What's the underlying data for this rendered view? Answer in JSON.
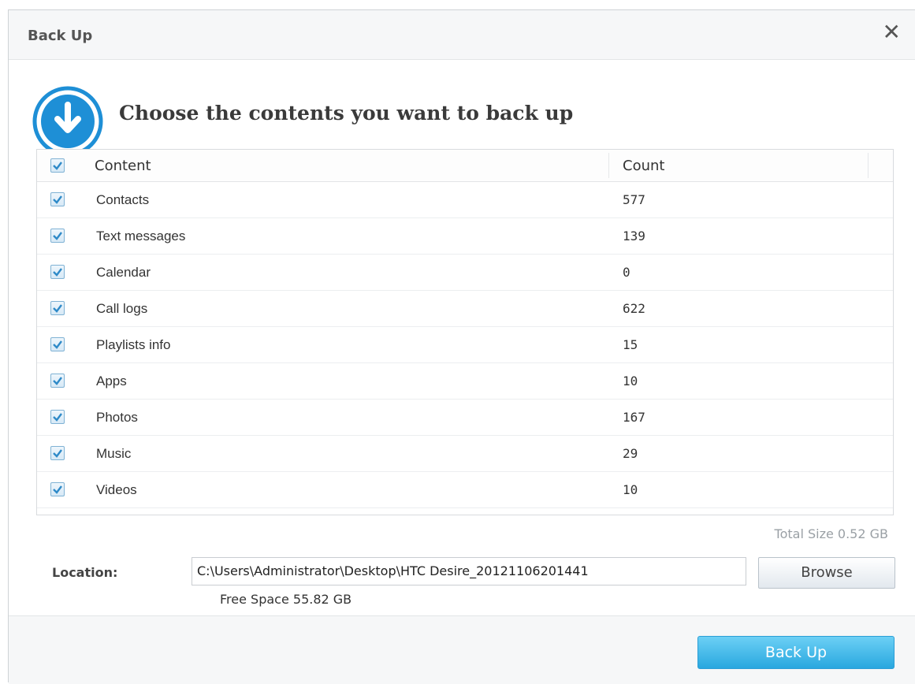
{
  "dialog": {
    "title": "Back Up",
    "close_glyph": "✕",
    "heading": "Choose the contents you want to back up",
    "header_icon": "download-arrow-icon"
  },
  "table": {
    "headers": {
      "content": "Content",
      "count": "Count"
    },
    "select_all_checked": true,
    "rows": [
      {
        "content": "Contacts",
        "count": "577",
        "checked": true
      },
      {
        "content": "Text messages",
        "count": "139",
        "checked": true
      },
      {
        "content": "Calendar",
        "count": "0",
        "checked": true
      },
      {
        "content": "Call logs",
        "count": "622",
        "checked": true
      },
      {
        "content": "Playlists info",
        "count": "15",
        "checked": true
      },
      {
        "content": "Apps",
        "count": "10",
        "checked": true
      },
      {
        "content": "Photos",
        "count": "167",
        "checked": true
      },
      {
        "content": "Music",
        "count": "29",
        "checked": true
      },
      {
        "content": "Videos",
        "count": "10",
        "checked": true
      }
    ]
  },
  "total_size": "Total Size 0.52 GB",
  "location": {
    "label": "Location:",
    "value": "C:\\Users\\Administrator\\Desktop\\HTC Desire_20121106201441",
    "browse_label": "Browse",
    "free_space": "Free Space 55.82 GB"
  },
  "footer": {
    "backup_label": "Back Up"
  },
  "colors": {
    "accent": "#29a7df",
    "icon_blue": "#1e8fd6",
    "check": "#2f8ac8"
  }
}
